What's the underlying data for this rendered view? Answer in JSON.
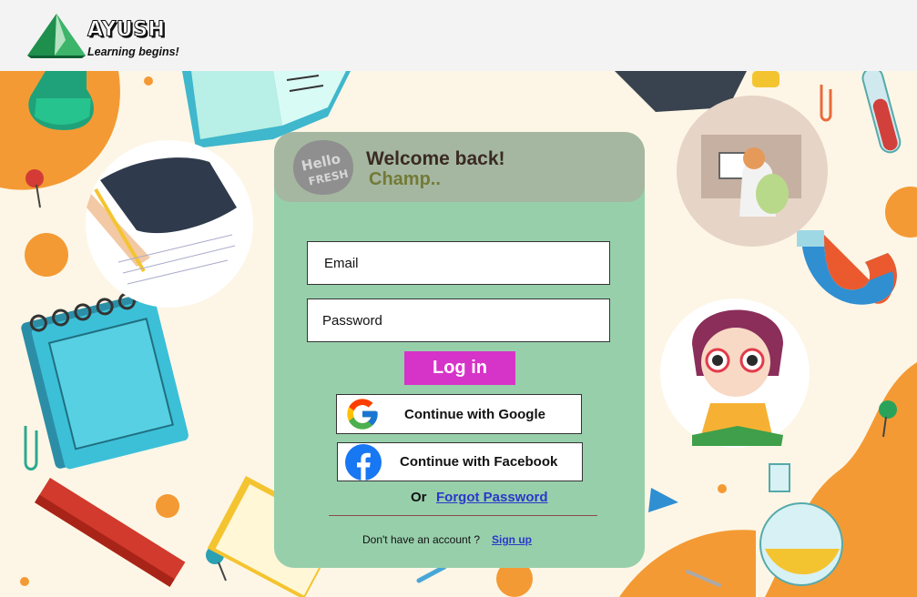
{
  "brand": {
    "name": "AYUSH",
    "tagline": "Learning begins!",
    "badge_text": "Hello FRESH"
  },
  "login_card": {
    "welcome": "Welcome back!",
    "subtitle": "Champ..",
    "email_placeholder": "Email",
    "password_placeholder": "Password",
    "login_label": "Log in",
    "google_label": "Continue with Google",
    "facebook_label": "Continue with Facebook",
    "or_label": "Or",
    "forgot_label": "Forgot Password",
    "signup_prompt": "Don't have an account ?",
    "signup_label": "Sign up"
  },
  "colors": {
    "header_bg": "#f3f3f3",
    "page_bg": "#fdf6e6",
    "card_bg": "#97cfab",
    "card_header_bg": "#a5b7a0",
    "login_button": "#d633c9",
    "link": "#2b38c9",
    "accent_orange": "#f49a34"
  },
  "icons": {
    "logo": "mountain-logo-icon",
    "google": "google-icon",
    "facebook": "facebook-icon"
  }
}
